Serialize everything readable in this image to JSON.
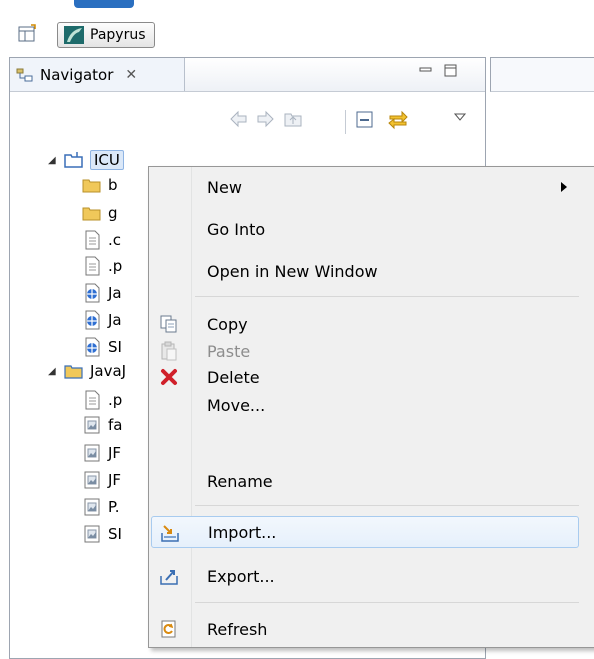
{
  "perspective": {
    "label": "Papyrus"
  },
  "navigator": {
    "tab_label": "Navigator",
    "close_glyph": "✕"
  },
  "tree": [
    {
      "label": "ICU",
      "kind": "project",
      "expanded": true,
      "selected": true
    },
    {
      "label": "b",
      "kind": "folder"
    },
    {
      "label": "g",
      "kind": "folder"
    },
    {
      "label": ".c",
      "kind": "file"
    },
    {
      "label": ".p",
      "kind": "file"
    },
    {
      "label": "Ja",
      "kind": "java"
    },
    {
      "label": "Ja",
      "kind": "java"
    },
    {
      "label": "SI",
      "kind": "java"
    },
    {
      "label": "JavaJ",
      "kind": "project",
      "expanded": true
    },
    {
      "label": ".p",
      "kind": "file"
    },
    {
      "label": "fa",
      "kind": "image"
    },
    {
      "label": "JF",
      "kind": "image"
    },
    {
      "label": "JF",
      "kind": "image"
    },
    {
      "label": "P.",
      "kind": "image"
    },
    {
      "label": "SI",
      "kind": "image"
    }
  ],
  "context_menu": {
    "items": [
      {
        "label": "New",
        "has_submenu": true
      },
      {
        "label": "Go Into"
      },
      {
        "label": "Open in New Window"
      },
      {
        "label": "Copy",
        "icon": "copy-icon"
      },
      {
        "label": "Paste",
        "icon": "paste-icon",
        "disabled": true
      },
      {
        "label": "Delete",
        "icon": "delete-icon"
      },
      {
        "label": "Move..."
      },
      {
        "label": "Rename"
      },
      {
        "label": "Import...",
        "icon": "import-icon",
        "hovered": true
      },
      {
        "label": "Export...",
        "icon": "export-icon"
      },
      {
        "label": "Refresh",
        "icon": "refresh-icon"
      }
    ]
  },
  "colors": {
    "selection_bg": "#dbe8f8",
    "hover_border": "#a8cbef",
    "delete_red": "#d0202a",
    "folder_yellow": "#f0c85a"
  }
}
